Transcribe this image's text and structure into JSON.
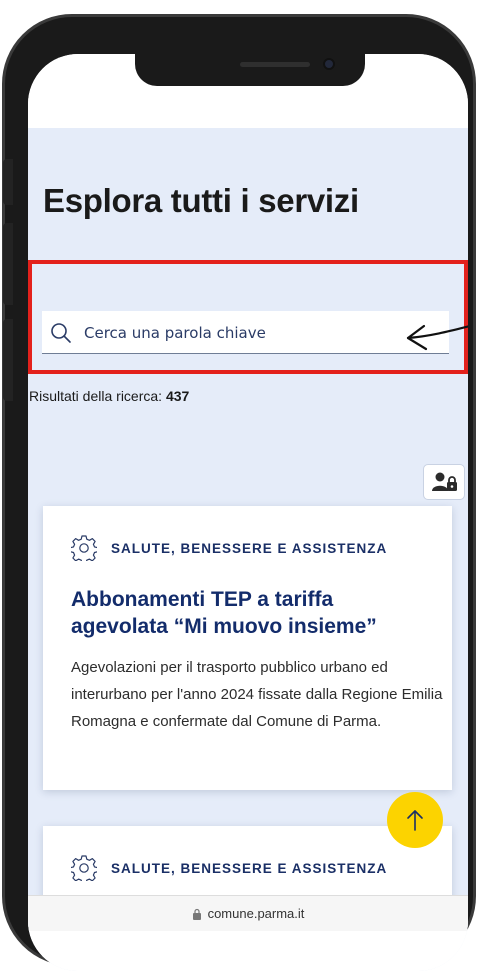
{
  "page": {
    "title": "Esplora tutti i servizi"
  },
  "search": {
    "placeholder": "Cerca una parola chiave",
    "value": ""
  },
  "results": {
    "label": "Risultati della ricerca:",
    "count": "437"
  },
  "cards": [
    {
      "category": "SALUTE, BENESSERE E ASSISTENZA",
      "icon": "gear-icon",
      "title": "Abbonamenti TEP a tariffa agevolata “Mi muovo insieme”",
      "description": "Agevolazioni per il trasporto pubblico urbano ed interurbano per l'anno 2024 fissate dalla Regione Emilia Romagna e confermate dal Comune di Parma."
    },
    {
      "category": "SALUTE, BENESSERE E ASSISTENZA",
      "icon": "gear-icon"
    }
  ],
  "browser": {
    "url": "comune.parma.it"
  },
  "icons": {
    "search": "search-icon",
    "login": "user-lock-icon",
    "back_to_top": "arrow-up-icon",
    "lock": "lock-icon"
  },
  "colors": {
    "hero_bg": "#e5ecf9",
    "primary_text": "#132c6b",
    "highlight": "#e3211c",
    "fab": "#fcd300"
  }
}
